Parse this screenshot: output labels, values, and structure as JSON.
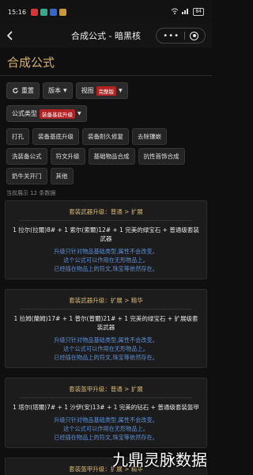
{
  "status_bar": {
    "time": "15:16",
    "battery": "84"
  },
  "nav": {
    "title": "合成公式 - 暗黑核"
  },
  "page_heading": "合成公式",
  "toolbar": {
    "reset_label": "重置",
    "version_label": "版本",
    "view_label": "视图",
    "view_badge": "完整版"
  },
  "filter": {
    "label": "公式类型",
    "badge": "装备基底升级"
  },
  "chips": [
    "打孔",
    "装备基底升级",
    "装备耐久修复",
    "去除镶嵌",
    "洗装备公式",
    "符文升级",
    "基础物品合成",
    "抗性首饰合成",
    "奶牛关开门",
    "其他"
  ],
  "count_text": "当前展示 12 条数据",
  "cards": [
    {
      "title": "套装武器升级：普通 > 扩展",
      "recipe": "1 拉尔(拉爾)8# + 1 索尔(索爾)12# + 1 完美的绿宝石 + 普通级套装武器",
      "desc": [
        "升级只针对物品基础类型,属性不会改变。",
        "这个公式可以作用在无形物品上。",
        "已经插在物品上的符文,珠宝等依然存在。"
      ]
    },
    {
      "title": "套装武器升级：扩展 > 精华",
      "recipe": "1 拉姆(蘭姆)17# + 1 普尔(普爾)21# + 1 完美的绿宝石 + 扩展级套装武器",
      "desc": [
        "升级只针对物品基础类型,属性不会改变。",
        "这个公式可以作用在无形物品上。",
        "已经插在物品上的符文,珠宝等依然存在。"
      ]
    },
    {
      "title": "套装盔甲升级：普通 > 扩展",
      "recipe": "1 塔尔(塔爾)7# + 1 沙伊(安)13# + 1 完美的钻石 + 普通级套装盔甲",
      "desc": [
        "升级只针对物品基础类型,属性不会改变。",
        "这个公式可以作用在无形物品上。",
        "已经插在物品上的符文,珠宝等依然存在。"
      ]
    },
    {
      "title": "套装盔甲升级：扩展 > 精华",
      "recipe": "",
      "desc": []
    }
  ],
  "watermark": "九鼎灵脉数据"
}
